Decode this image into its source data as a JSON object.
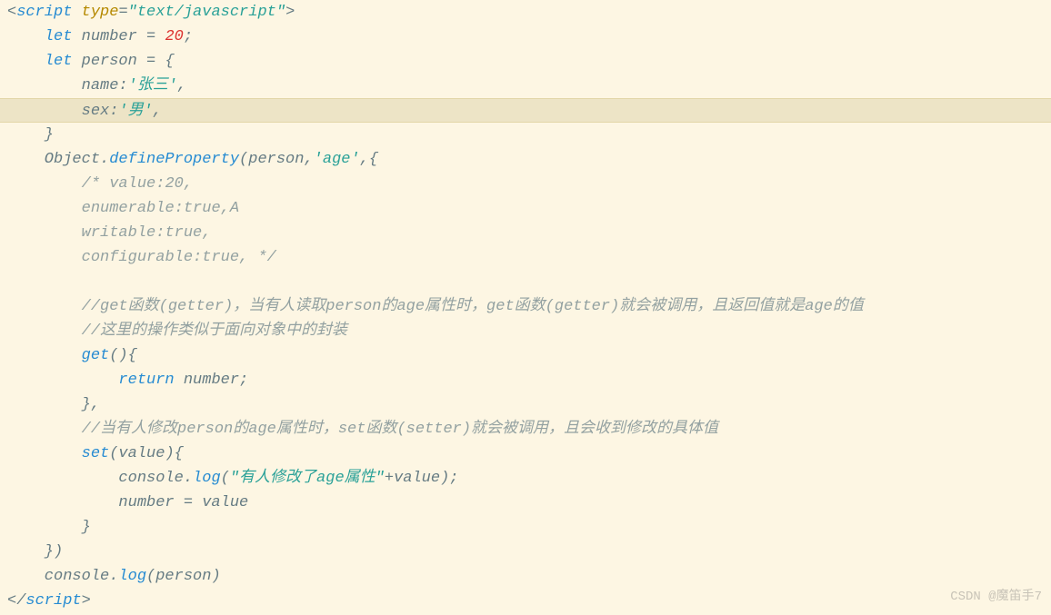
{
  "watermark": "CSDN @魔笛手7",
  "code": {
    "lines": [
      {
        "hl": false,
        "tokens": [
          {
            "c": "punct",
            "t": "<"
          },
          {
            "c": "tag",
            "t": "script "
          },
          {
            "c": "attr",
            "t": "type"
          },
          {
            "c": "punct",
            "t": "="
          },
          {
            "c": "string",
            "t": "\"text/javascript\""
          },
          {
            "c": "punct",
            "t": ">"
          }
        ]
      },
      {
        "hl": false,
        "tokens": [
          {
            "c": "",
            "t": "    "
          },
          {
            "c": "keyword",
            "t": "let"
          },
          {
            "c": "",
            "t": " number = "
          },
          {
            "c": "number",
            "t": "20"
          },
          {
            "c": "",
            "t": ";"
          }
        ]
      },
      {
        "hl": false,
        "tokens": [
          {
            "c": "",
            "t": "    "
          },
          {
            "c": "keyword",
            "t": "let"
          },
          {
            "c": "",
            "t": " person = {"
          }
        ]
      },
      {
        "hl": false,
        "tokens": [
          {
            "c": "",
            "t": "        name:"
          },
          {
            "c": "string",
            "t": "'张三'"
          },
          {
            "c": "",
            "t": ","
          }
        ]
      },
      {
        "hl": true,
        "tokens": [
          {
            "c": "",
            "t": "        sex:"
          },
          {
            "c": "string",
            "t": "'男'"
          },
          {
            "c": "",
            "t": ","
          }
        ]
      },
      {
        "hl": false,
        "tokens": [
          {
            "c": "",
            "t": "    }"
          }
        ]
      },
      {
        "hl": false,
        "tokens": [
          {
            "c": "",
            "t": "    Object."
          },
          {
            "c": "func",
            "t": "defineProperty"
          },
          {
            "c": "",
            "t": "(person,"
          },
          {
            "c": "string",
            "t": "'age'"
          },
          {
            "c": "",
            "t": ",{"
          }
        ]
      },
      {
        "hl": false,
        "tokens": [
          {
            "c": "",
            "t": "        "
          },
          {
            "c": "comment",
            "t": "/* value:20,"
          }
        ]
      },
      {
        "hl": false,
        "tokens": [
          {
            "c": "",
            "t": "        "
          },
          {
            "c": "comment",
            "t": "enumerable:true,A"
          }
        ]
      },
      {
        "hl": false,
        "tokens": [
          {
            "c": "",
            "t": "        "
          },
          {
            "c": "comment",
            "t": "writable:true,"
          }
        ]
      },
      {
        "hl": false,
        "tokens": [
          {
            "c": "",
            "t": "        "
          },
          {
            "c": "comment",
            "t": "configurable:true, */"
          }
        ]
      },
      {
        "hl": false,
        "tokens": [
          {
            "c": "",
            "t": " "
          }
        ]
      },
      {
        "hl": false,
        "tokens": [
          {
            "c": "",
            "t": "        "
          },
          {
            "c": "comment",
            "t": "//get函数(getter)，当有人读取person的age属性时，get函数(getter)就会被调用，且返回值就是age的值"
          }
        ]
      },
      {
        "hl": false,
        "tokens": [
          {
            "c": "",
            "t": "        "
          },
          {
            "c": "comment",
            "t": "//这里的操作类似于面向对象中的封装"
          }
        ]
      },
      {
        "hl": false,
        "tokens": [
          {
            "c": "",
            "t": "        "
          },
          {
            "c": "func",
            "t": "get"
          },
          {
            "c": "",
            "t": "(){"
          }
        ]
      },
      {
        "hl": false,
        "tokens": [
          {
            "c": "",
            "t": "            "
          },
          {
            "c": "keyword",
            "t": "return"
          },
          {
            "c": "",
            "t": " number;"
          }
        ]
      },
      {
        "hl": false,
        "tokens": [
          {
            "c": "",
            "t": "        },"
          }
        ]
      },
      {
        "hl": false,
        "tokens": [
          {
            "c": "",
            "t": "        "
          },
          {
            "c": "comment",
            "t": "//当有人修改person的age属性时，set函数(setter)就会被调用，且会收到修改的具体值"
          }
        ]
      },
      {
        "hl": false,
        "tokens": [
          {
            "c": "",
            "t": "        "
          },
          {
            "c": "func",
            "t": "set"
          },
          {
            "c": "",
            "t": "(value){"
          }
        ]
      },
      {
        "hl": false,
        "tokens": [
          {
            "c": "",
            "t": "            console."
          },
          {
            "c": "func",
            "t": "log"
          },
          {
            "c": "",
            "t": "("
          },
          {
            "c": "string",
            "t": "\"有人修改了age属性\""
          },
          {
            "c": "",
            "t": "+value);"
          }
        ]
      },
      {
        "hl": false,
        "tokens": [
          {
            "c": "",
            "t": "            number = value"
          }
        ]
      },
      {
        "hl": false,
        "tokens": [
          {
            "c": "",
            "t": "        }"
          }
        ]
      },
      {
        "hl": false,
        "tokens": [
          {
            "c": "",
            "t": "    })"
          }
        ]
      },
      {
        "hl": false,
        "tokens": [
          {
            "c": "",
            "t": "    console."
          },
          {
            "c": "func",
            "t": "log"
          },
          {
            "c": "",
            "t": "(person)"
          }
        ]
      },
      {
        "hl": false,
        "tokens": [
          {
            "c": "punct",
            "t": "</"
          },
          {
            "c": "tag",
            "t": "script"
          },
          {
            "c": "punct",
            "t": ">"
          }
        ]
      }
    ]
  }
}
